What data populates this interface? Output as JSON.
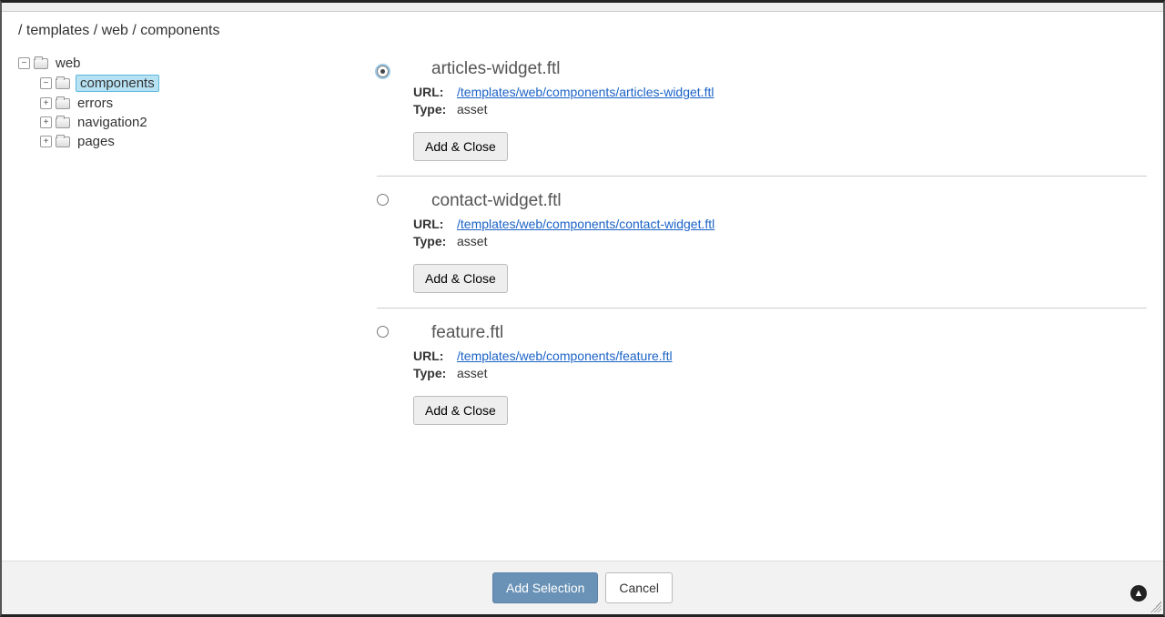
{
  "breadcrumb": "/ templates / web / components",
  "tree": {
    "root": {
      "label": "web",
      "expanded": true,
      "children": [
        {
          "label": "components",
          "selected": true,
          "expanded": false
        },
        {
          "label": "errors",
          "expanded": false
        },
        {
          "label": "navigation2",
          "expanded": false
        },
        {
          "label": "pages",
          "expanded": false
        }
      ]
    }
  },
  "labels": {
    "url": "URL:",
    "type": "Type:",
    "add_close": "Add & Close"
  },
  "items": [
    {
      "title": "articles-widget.ftl",
      "url": "/templates/web/components/articles-widget.ftl",
      "type": "asset",
      "selected": true
    },
    {
      "title": "contact-widget.ftl",
      "url": "/templates/web/components/contact-widget.ftl",
      "type": "asset",
      "selected": false
    },
    {
      "title": "feature.ftl",
      "url": "/templates/web/components/feature.ftl",
      "type": "asset",
      "selected": false
    }
  ],
  "footer": {
    "add_selection": "Add Selection",
    "cancel": "Cancel"
  }
}
